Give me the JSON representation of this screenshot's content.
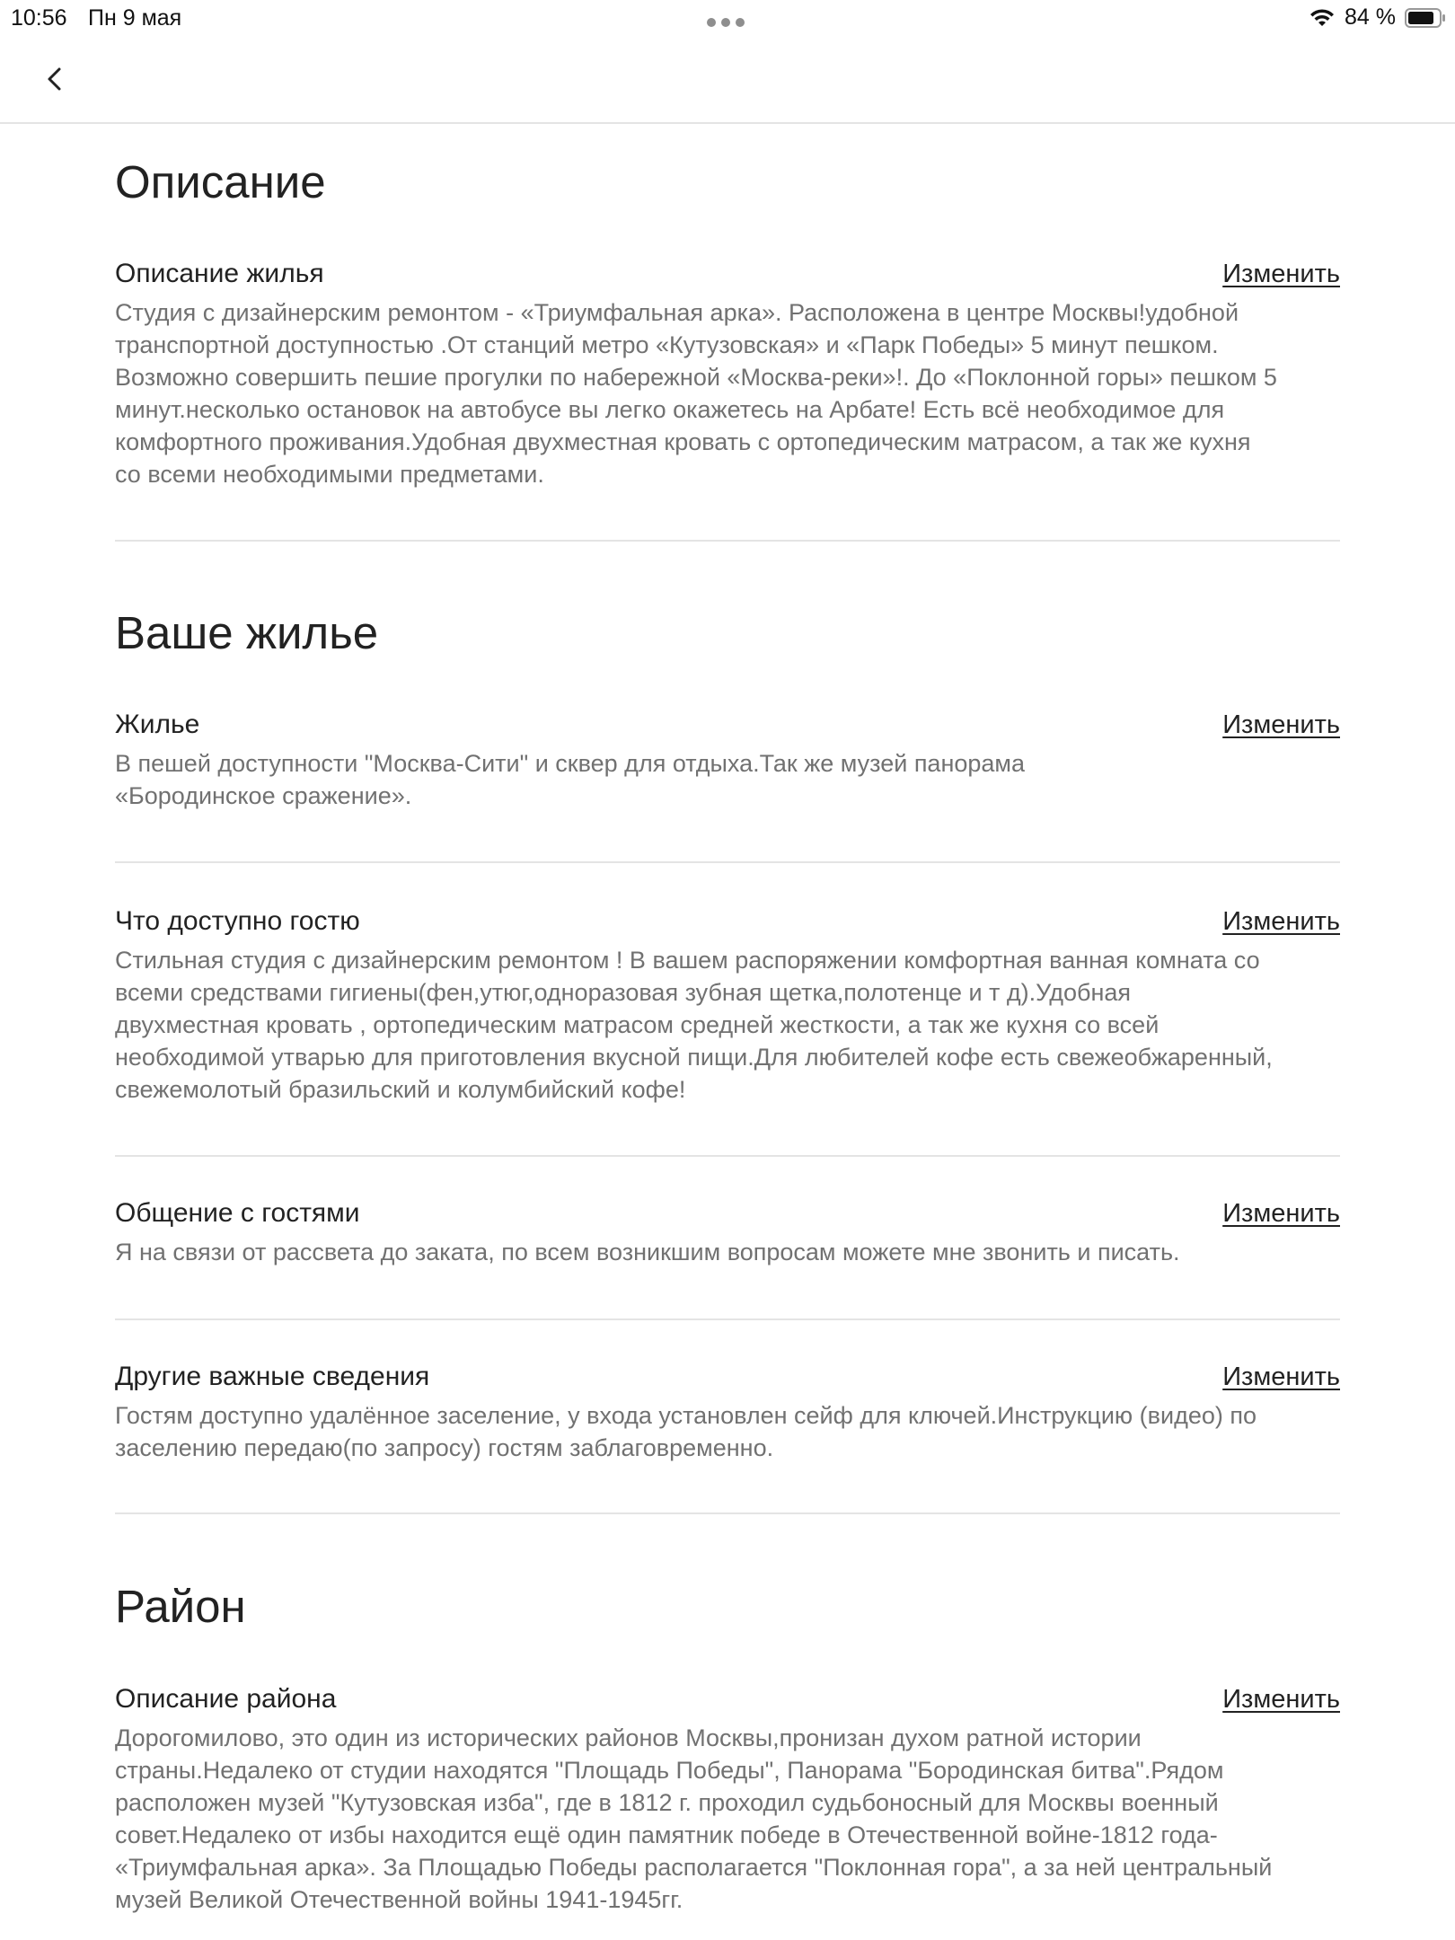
{
  "status_bar": {
    "time": "10:56",
    "date": "Пн 9 мая",
    "battery": "84 %"
  },
  "sections": [
    {
      "title": "Описание",
      "fields": [
        {
          "label": "Описание жилья",
          "edit": "Изменить",
          "text": "Студия с дизайнерским ремонтом - «Триумфальная арка». Расположена в центре Москвы!удобной\nтранспортной доступностью .От станций метро «Кутузовская» и «Парк Победы» 5 минут пешком.\nВозможно совершить пешие прогулки по набережной «Москва-реки»!. До «Поклонной  горы» пешком 5\nминут.несколько остановок на автобусе вы легко окажетесь на Арбате! Есть всё  необходимое для\nкомфортного проживания.Удобная двухместная кровать с ортопедическим матрасом, а так же кухня\nсо всеми необходимыми предметами."
        }
      ]
    },
    {
      "title": "Ваше жилье",
      "fields": [
        {
          "label": "Жилье",
          "edit": "Изменить",
          "text": "В пешей доступности \"Москва-Сити\" и сквер для отдыха.Так же музей панорама\n«Бородинское сражение»."
        },
        {
          "label": "Что доступно гостю",
          "edit": "Изменить",
          "text": "Стильная студия с дизайнерским ремонтом ! В вашем распоряжении комфортная ванная комната со\nвсеми средствами гигиены(фен,утюг,одноразовая зубная щетка,полотенце и т д).Удобная\nдвухместная кровать , ортопедическим матрасом средней жесткости, а так же кухня со всей\nнеобходимой утварью для приготовления вкусной пищи.Для любителей кофе есть свежеобжаренный,\nсвежемолотый бразильский и колумбийский кофе!"
        },
        {
          "label": "Общение с гостями",
          "edit": "Изменить",
          "text": "Я на связи от рассвета до заката, по всем возникшим вопросам можете мне звонить и писать."
        },
        {
          "label": "Другие важные сведения",
          "edit": "Изменить",
          "text": "Гостям доступно удалённое заселение, у входа установлен сейф для ключей.Инструкцию (видео) по\nзаселению передаю(по запросу) гостям  заблаговременно."
        }
      ]
    },
    {
      "title": "Район",
      "fields": [
        {
          "label": "Описание района",
          "edit": "Изменить",
          "text": "Дорогомилово, это один из исторических районов Москвы,пронизан духом ратной истории\nстраны.Недалеко от студии находятся \"Площадь Победы\", Панорама \"Бородинская битва\".Рядом\nрасположен музей \"Кутузовская изба\", где в 1812 г. проходил судьбоносный для Москвы военный\nсовет.Недалеко от избы находится ещё один памятник победе в Отечественной войне-1812 года-\n«Триумфальная арка». За Площадью Победы располагается  \"Поклонная гора\", а за ней центральный\nмузей Великой Отечественной войны 1941-1945гг."
        }
      ]
    }
  ]
}
